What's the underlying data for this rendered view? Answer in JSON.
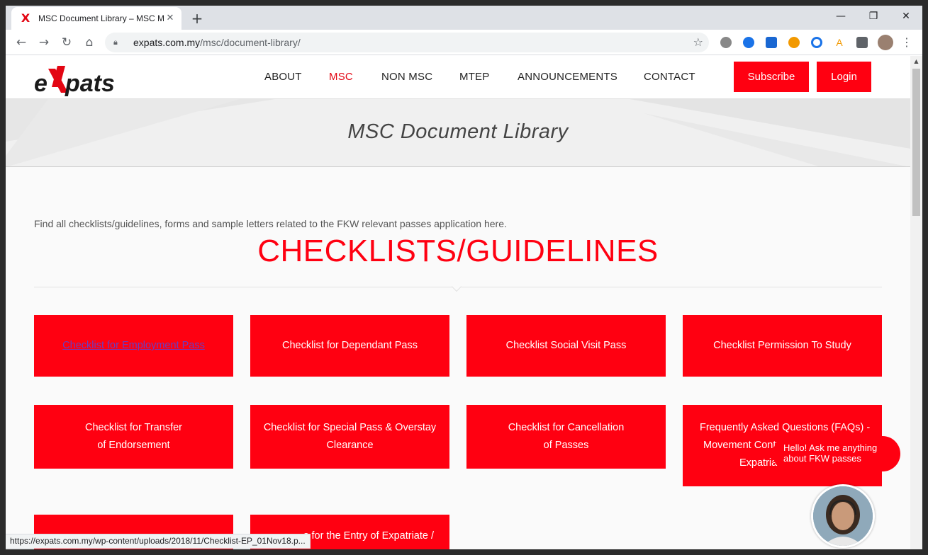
{
  "browser": {
    "tab_title": "MSC Document Library – MSC M",
    "tab_favicon": "X",
    "url_host": "expats.com.my",
    "url_path": "/msc/document-library/",
    "new_tab": "+",
    "minimize": "—",
    "maximize": "❐",
    "close": "✕",
    "tab_close": "✕",
    "status_url": "https://expats.com.my/wp-content/uploads/2018/11/Checklist-EP_01Nov18.p..."
  },
  "site": {
    "nav": [
      "ABOUT",
      "MSC",
      "NON MSC",
      "MTEP",
      "ANNOUNCEMENTS",
      "CONTACT"
    ],
    "subscribe_label": "Subscribe",
    "login_label": "Login",
    "banner_title": "MSC Document Library",
    "intro": "Find all checklists/guidelines, forms and sample letters related to the FKW relevant passes application here.",
    "section_title": "CHECKLISTS/GUIDELINES",
    "cards": [
      {
        "line1": "Checklist for Employment Pass",
        "line2": ""
      },
      {
        "line1": "Checklist for Dependant Pass",
        "line2": ""
      },
      {
        "line1": "Checklist Social Visit Pass",
        "line2": ""
      },
      {
        "line1": "Checklist Permission To Study",
        "line2": ""
      },
      {
        "line1": "Checklist for Transfer",
        "line2": "of Endorsement"
      },
      {
        "line1": "Checklist for Special Pass & Overstay",
        "line2": "Clearance"
      },
      {
        "line1": "Checklist for Cancellation",
        "line2": "of Passes"
      },
      {
        "line1": "Frequently Asked Questions (FAQs) -",
        "line2": "Movement Contr",
        "line3": "Expatria"
      },
      {
        "line1": "",
        "line2": ""
      },
      {
        "line1": "s for the Entry of Expatriate /",
        "line2": ""
      }
    ],
    "chat": {
      "line1": "Hello! Ask me anything",
      "line2": "about FKW passes"
    }
  },
  "colors": {
    "brand_red": "#ff0011",
    "link_visited": "#6a3dc2"
  }
}
